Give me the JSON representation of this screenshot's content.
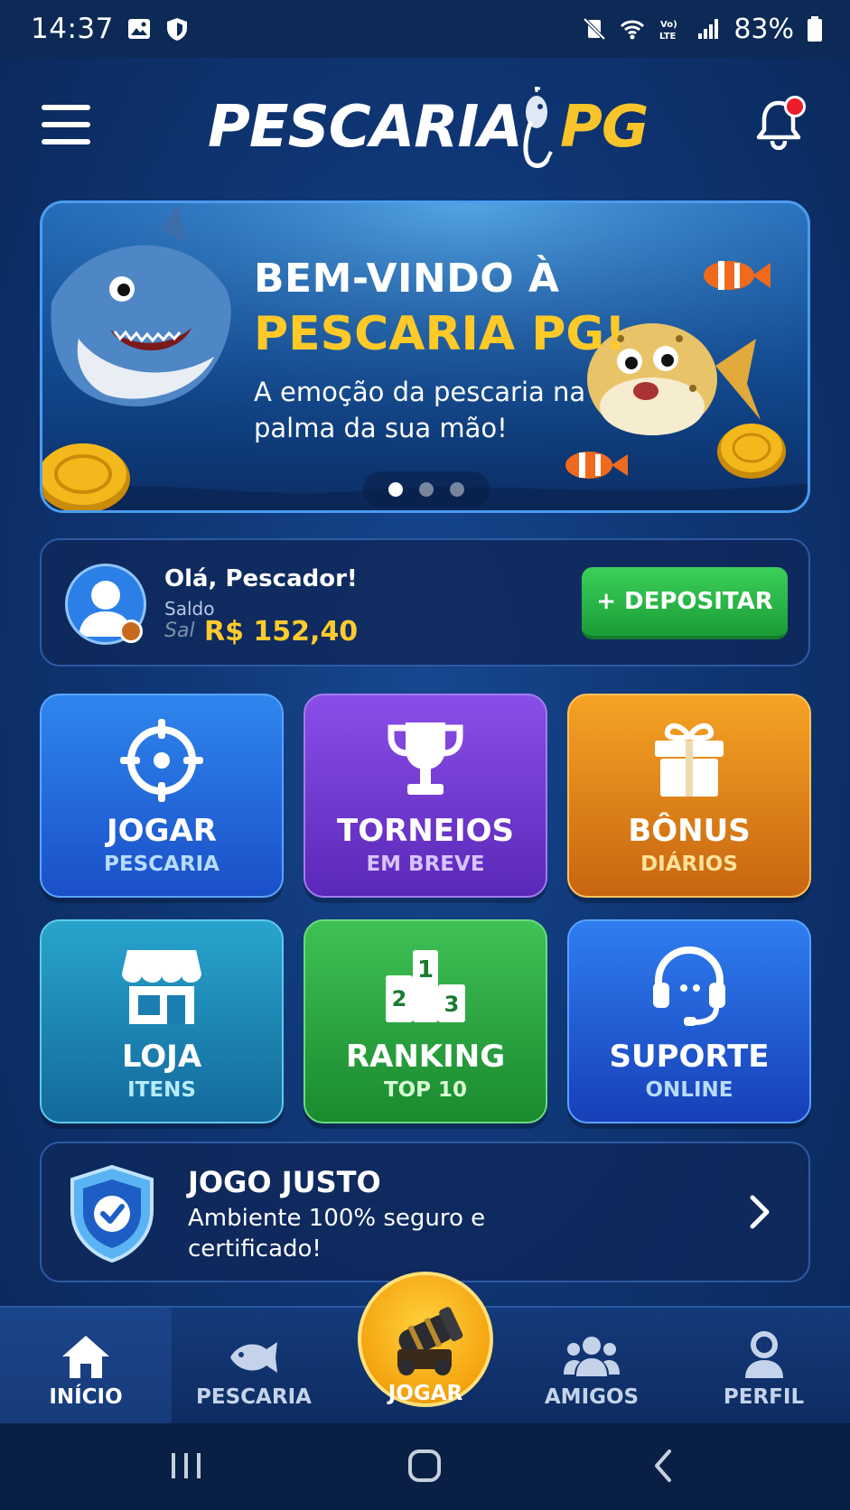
{
  "status_bar": {
    "time": "14:37",
    "battery": "83%",
    "icons": [
      "gallery-icon",
      "shield-icon",
      "mute-icon",
      "wifi-icon",
      "volte-icon",
      "signal-icon",
      "battery-icon"
    ]
  },
  "header": {
    "logo_part1": "PESCARIA",
    "logo_part2": "PG",
    "menu_icon": "hamburger-menu-icon",
    "notification_icon": "bell-icon",
    "has_notification": true
  },
  "banner": {
    "line1": "BEM-VINDO À",
    "line2": "PESCARIA PG!",
    "line3": "A emoção da pescaria na palma da sua mão!",
    "active_slide": 1,
    "slide_count": 3
  },
  "user": {
    "greeting": "Olá, Pescador!",
    "balance_label": "Saldo",
    "balance_ghost": "Sal",
    "balance_value": "R$ 152,40",
    "deposit_label": "+ DEPOSITAR"
  },
  "tiles": [
    {
      "title": "JOGAR",
      "subtitle": "PESCARIA",
      "icon": "crosshair-icon"
    },
    {
      "title": "TORNEIOS",
      "subtitle": "EM BREVE",
      "icon": "trophy-icon"
    },
    {
      "title": "BÔNUS",
      "subtitle": "DIÁRIOS",
      "icon": "gift-icon"
    },
    {
      "title": "LOJA",
      "subtitle": "ITENS",
      "icon": "store-icon"
    },
    {
      "title": "RANKING",
      "subtitle": "TOP 10",
      "icon": "podium-icon"
    },
    {
      "title": "SUPORTE",
      "subtitle": "ONLINE",
      "icon": "headset-icon"
    }
  ],
  "fair_play": {
    "title": "JOGO JUSTO",
    "description": "Ambiente 100% seguro e certificado!",
    "icon": "shield-check-icon"
  },
  "bottom_nav": {
    "items": [
      {
        "label": "INÍCIO",
        "icon": "home-icon",
        "active": true
      },
      {
        "label": "PESCARIA",
        "icon": "fish-icon",
        "active": false
      },
      {
        "label": "JOGAR",
        "icon": "cannon-icon",
        "active": false
      },
      {
        "label": "AMIGOS",
        "icon": "friends-icon",
        "active": false
      },
      {
        "label": "PERFIL",
        "icon": "profile-icon",
        "active": false
      }
    ]
  },
  "colors": {
    "accent_gold": "#ffc928",
    "deposit_green": "#1a9d37",
    "background": "#0f3675"
  }
}
